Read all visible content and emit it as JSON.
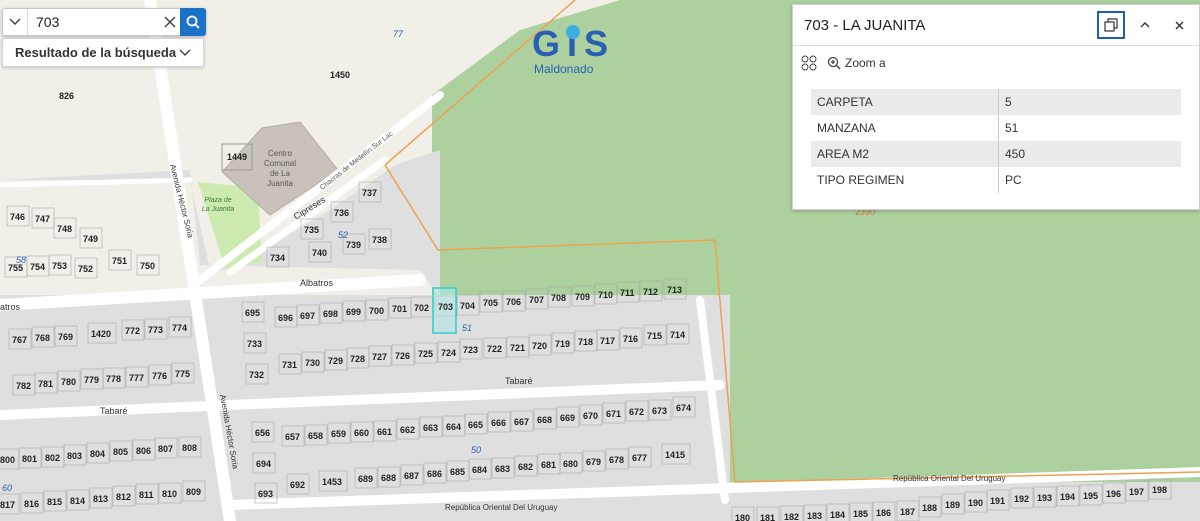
{
  "search": {
    "value": "703",
    "placeholder": ""
  },
  "results_label": "Resultado de la búsqueda",
  "logo": {
    "text_top": "GIS",
    "text_bottom": "Maldonado"
  },
  "panel": {
    "title": "703 - LA JUANITA",
    "zoom_label": "Zoom a",
    "rows": [
      {
        "key": "CARPETA",
        "value": "5"
      },
      {
        "key": "MANZANA",
        "value": "51"
      },
      {
        "key": "AREA M2",
        "value": "450"
      },
      {
        "key": "TIPO REGIMEN",
        "value": "PC"
      }
    ]
  },
  "map": {
    "streets": [
      "Albatros",
      "Tabaré",
      "Tabaré",
      "Cipreses",
      "Avenida Héctor Soria",
      "Avenida Héctor Soria",
      "República Oriental Del Uruguay",
      "República Oriental Del Uruguay",
      "Chacras de Medellín Sur Lac"
    ],
    "landmarks": [
      "Centro",
      "Comunal",
      "de La",
      "Juanita",
      "Plaza de",
      "La Juanita"
    ],
    "block_numbers": [
      "77",
      "52",
      "51",
      "50",
      "58",
      "60"
    ],
    "orange_label": "2390",
    "big_lots": [
      "1450",
      "826",
      "1449"
    ],
    "lots": {
      "r_top_left": [
        "746",
        "747",
        "748",
        "749",
        "755",
        "754",
        "753",
        "752",
        "751",
        "750"
      ],
      "r_cipreses": [
        "737",
        "736",
        "735",
        "739",
        "738",
        "734",
        "740"
      ],
      "r_alb_n": [
        "695",
        "696",
        "697",
        "698",
        "699",
        "700",
        "701",
        "702",
        "703",
        "704",
        "705",
        "706",
        "707",
        "708",
        "709",
        "710",
        "711",
        "712",
        "713"
      ],
      "r_alb_s": [
        "733",
        "732",
        "731",
        "730",
        "729",
        "728",
        "727",
        "726",
        "725",
        "724",
        "723",
        "722",
        "721",
        "720",
        "719",
        "718",
        "717",
        "716",
        "715",
        "714"
      ],
      "r_left_a": [
        "767",
        "768",
        "769",
        "1420",
        "772",
        "773",
        "774"
      ],
      "r_left_b": [
        "782",
        "781",
        "780",
        "779",
        "778",
        "777",
        "776",
        "775"
      ],
      "r_tab_n": [
        "656",
        "657",
        "658",
        "659",
        "660",
        "661",
        "662",
        "663",
        "664",
        "665",
        "666",
        "667",
        "668",
        "669",
        "670",
        "671",
        "672",
        "673",
        "674"
      ],
      "r_tab_s": [
        "694",
        "693",
        "692",
        "1453",
        "689",
        "688",
        "687",
        "686",
        "685",
        "684",
        "683",
        "682",
        "681",
        "680",
        "679",
        "678",
        "677",
        "1415"
      ],
      "r_left_c": [
        "800",
        "801",
        "802",
        "803",
        "804",
        "805",
        "806",
        "807",
        "808"
      ],
      "r_left_d": [
        "817",
        "816",
        "815",
        "814",
        "813",
        "812",
        "811",
        "810",
        "809"
      ],
      "r_bottom": [
        "180",
        "181",
        "182",
        "183",
        "184",
        "185",
        "186",
        "187",
        "188",
        "189",
        "190",
        "191",
        "192",
        "193",
        "194",
        "195",
        "196",
        "197",
        "198"
      ]
    }
  }
}
